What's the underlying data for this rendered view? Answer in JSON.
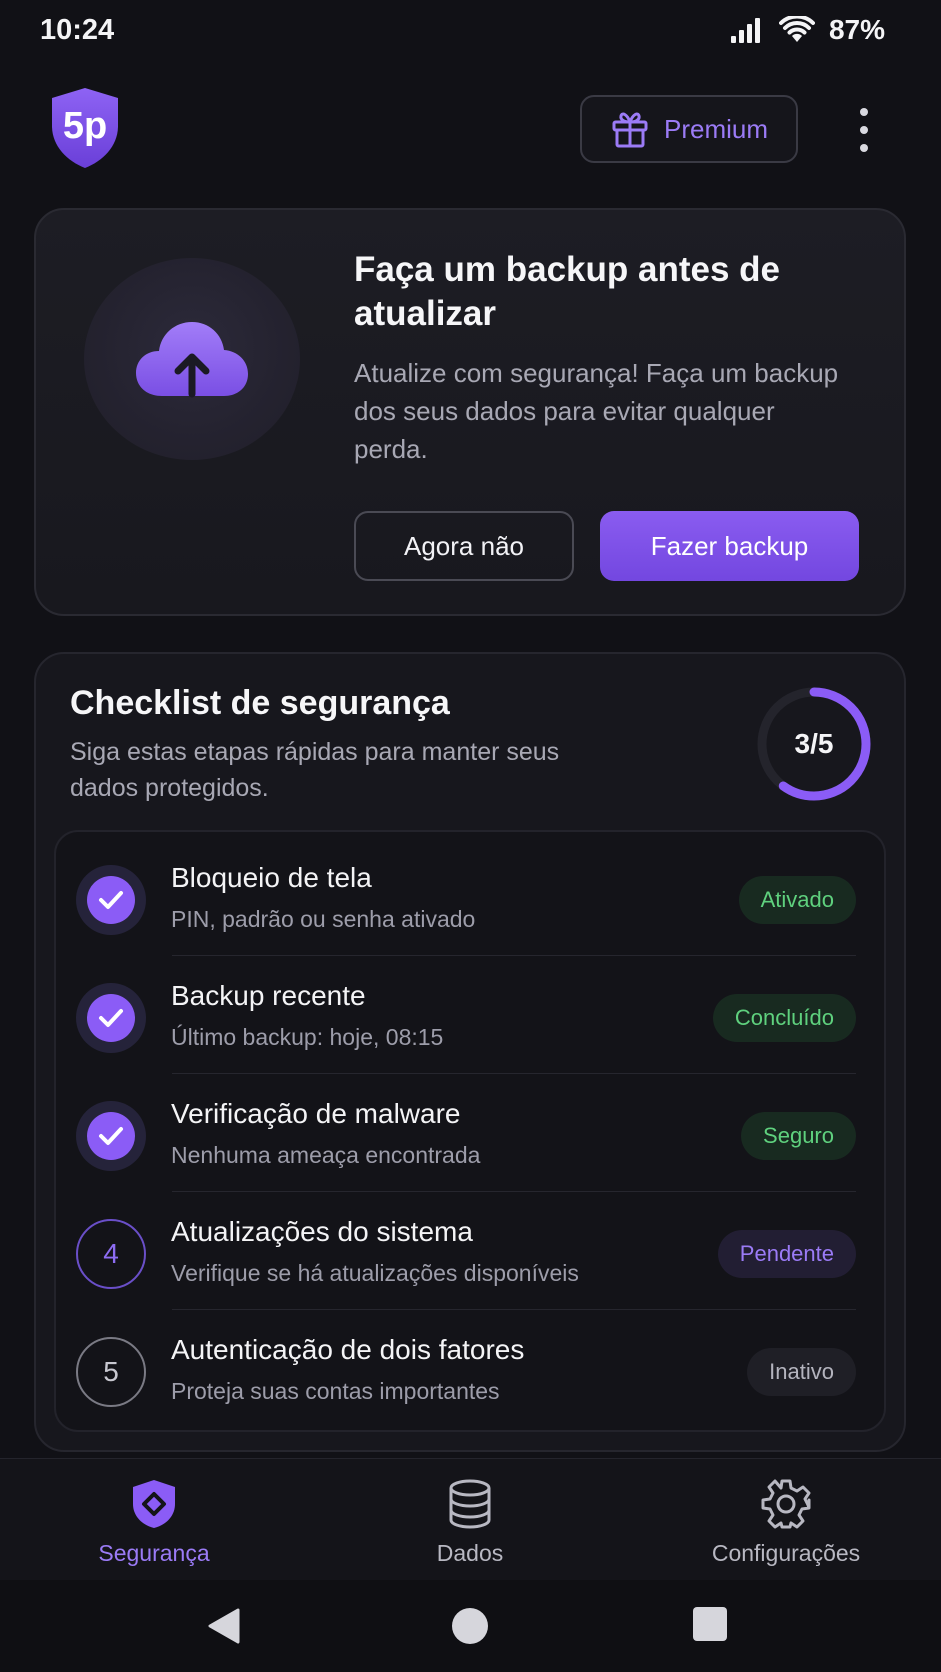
{
  "status_bar": {
    "time": "10:24",
    "battery": "87%"
  },
  "header": {
    "logo_text": "5p",
    "premium_label": "Premium"
  },
  "backup_card": {
    "title": "Faça um backup antes de atualizar",
    "description": "Atualize com segurança! Faça um backup dos seus dados para evitar qualquer perda.",
    "secondary_button": "Agora não",
    "primary_button": "Fazer backup"
  },
  "checklist": {
    "title": "Checklist de segurança",
    "subtitle": "Siga estas etapas rápidas para manter seus dados protegidos.",
    "progress_label": "3/5",
    "progress_fraction": 0.6,
    "items": [
      {
        "title": "Bloqueio de tela",
        "subtitle": "PIN, padrão ou senha ativado",
        "status": "Ativado",
        "state": "done"
      },
      {
        "title": "Backup recente",
        "subtitle": "Último backup: hoje, 08:15",
        "status": "Concluído",
        "state": "done"
      },
      {
        "title": "Verificação de malware",
        "subtitle": "Nenhuma ameaça encontrada",
        "status": "Seguro",
        "state": "done"
      },
      {
        "title": "Atualizações do sistema",
        "subtitle": "Verifique se há atualizações disponíveis",
        "status": "Pendente",
        "state": "pending",
        "number": "4"
      },
      {
        "title": "Autenticação de dois fatores",
        "subtitle": "Proteja suas contas importantes",
        "status": "Inativo",
        "state": "inactive",
        "number": "5"
      }
    ]
  },
  "bottom_nav": {
    "items": [
      {
        "label": "Segurança",
        "icon": "shield-icon",
        "active": true
      },
      {
        "label": "Dados",
        "icon": "database-icon",
        "active": false
      },
      {
        "label": "Configurações",
        "icon": "gear-icon",
        "active": false
      }
    ]
  },
  "colors": {
    "accent": "#8b5cf6",
    "success": "#5fd17e",
    "background": "#111116"
  }
}
